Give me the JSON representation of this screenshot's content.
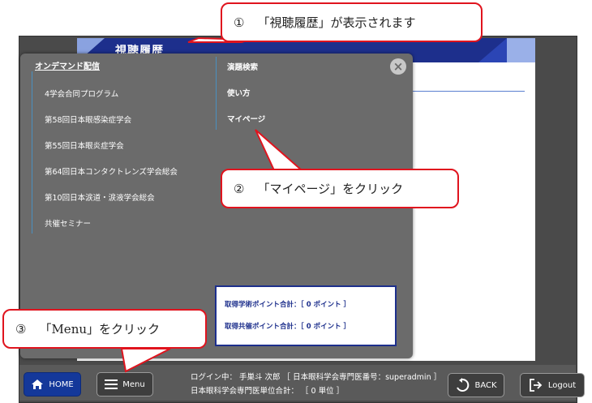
{
  "page": {
    "title": "視聴履歴"
  },
  "menu": {
    "section_header": "オンデマンド配信",
    "items": [
      "4学会合同プログラム",
      "第58回日本眼感染症学会",
      "第55回日本眼炎症学会",
      "第64回日本コンタクトレンズ学会総会",
      "第10回日本涙道・涙液学会総会",
      "共催セミナー"
    ],
    "right_items": [
      "演題検索",
      "使い方",
      "マイページ"
    ],
    "close_icon": "×",
    "points": {
      "academic": "取得学術ポイント合計：［ 0 ポイント ］",
      "sponsored": "取得共催ポイント合計：［ 0 ポイント ］"
    }
  },
  "bottom": {
    "home_label": "HOME",
    "menu_label": "Menu",
    "back_label": "BACK",
    "logout_label": "Logout",
    "login_line": "ログイン中： 手巣斗 次郎 ［ 日本眼科学会専門医番号：superadmin ］",
    "units_line": "日本眼科学会専門医単位合計： ［ 0 単位 ］"
  },
  "callouts": {
    "c1_num": "①",
    "c1_text": "「視聴履歴」が表示されます",
    "c2_num": "②",
    "c2_text": "「マイページ」をクリック",
    "c3_num": "③",
    "c3_text": "「Menu」をクリック"
  },
  "icons": {
    "home": "home-icon",
    "menu": "hamburger-icon",
    "back": "back-arrow-icon",
    "logout": "logout-icon"
  },
  "colors": {
    "navy": "#1d2f8c",
    "callout_border": "#e0141e",
    "menu_bg": "#6b6b6b"
  }
}
